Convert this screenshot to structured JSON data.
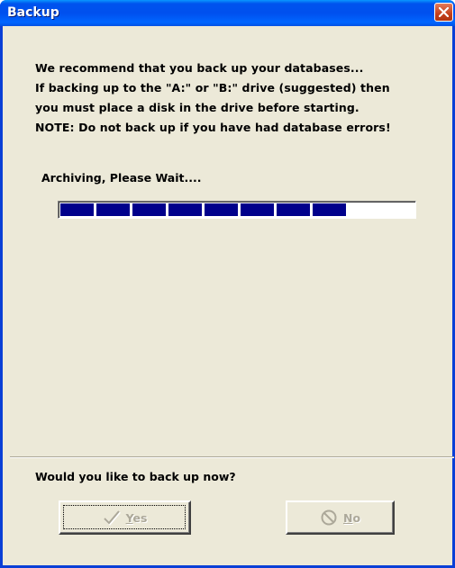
{
  "window": {
    "title": "Backup"
  },
  "message": {
    "lines": [
      "We recommend that you back up your databases...",
      "If backing up to the \"A:\" or \"B:\" drive (suggested) then",
      "you must place a disk in the drive before starting.",
      "NOTE: Do not back up if you have had database errors!"
    ]
  },
  "status": {
    "text": "Archiving, Please Wait...."
  },
  "progress": {
    "value_percent": 80,
    "segments_total": 10,
    "segments_filled": 8,
    "color": "#00008b"
  },
  "prompt": {
    "question": "Would you like to back up now?"
  },
  "buttons": {
    "yes": {
      "label": "Yes",
      "mnemonic": "Y",
      "rest": "es",
      "icon": "checkmark-icon",
      "enabled": false
    },
    "no": {
      "label": "No",
      "mnemonic": "N",
      "rest": "o",
      "icon": "prohibited-icon",
      "enabled": false
    }
  },
  "colors": {
    "titlebar": "#0053ee",
    "close_button": "#c4401c",
    "dialog_background": "#ece9d8",
    "disabled_text": "#aca899"
  }
}
